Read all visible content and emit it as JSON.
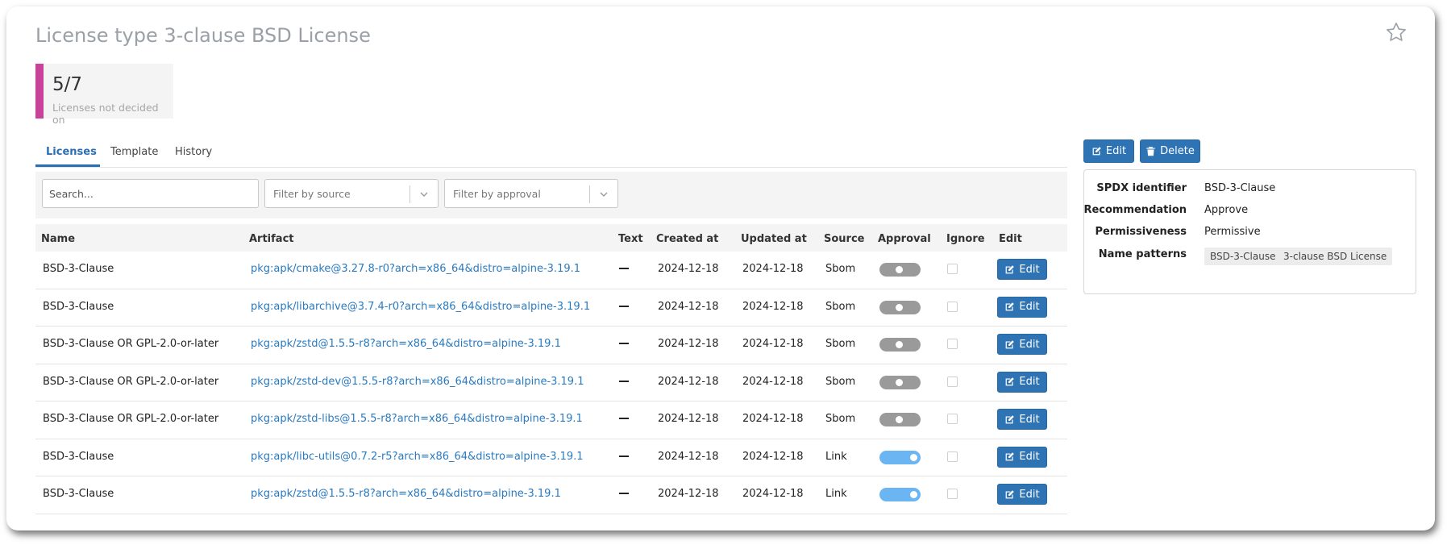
{
  "page": {
    "title": "License type 3-clause BSD License",
    "favorite_icon": "star-icon"
  },
  "stat": {
    "value": "5/7",
    "label": "Licenses not decided on",
    "accent_color": "#c9429a"
  },
  "tabs": [
    {
      "label": "Licenses",
      "active": true
    },
    {
      "label": "Template",
      "active": false
    },
    {
      "label": "History",
      "active": false
    }
  ],
  "filters": {
    "search_placeholder": "Search...",
    "source_placeholder": "Filter by source",
    "approval_placeholder": "Filter by approval"
  },
  "table": {
    "columns": [
      "Name",
      "Artifact",
      "Text",
      "Created at",
      "Updated at",
      "Source",
      "Approval",
      "Ignore",
      "Edit"
    ],
    "edit_label": "Edit",
    "rows": [
      {
        "name": "BSD-3-Clause",
        "artifact": "pkg:apk/cmake@3.27.8-r0?arch=x86_64&distro=alpine-3.19.1",
        "text": "—",
        "created": "2024-12-18",
        "updated": "2024-12-18",
        "source": "Sbom",
        "approved": false,
        "ignored": false
      },
      {
        "name": "BSD-3-Clause",
        "artifact": "pkg:apk/libarchive@3.7.4-r0?arch=x86_64&distro=alpine-3.19.1",
        "text": "—",
        "created": "2024-12-18",
        "updated": "2024-12-18",
        "source": "Sbom",
        "approved": false,
        "ignored": false
      },
      {
        "name": "BSD-3-Clause OR GPL-2.0-or-later",
        "artifact": "pkg:apk/zstd@1.5.5-r8?arch=x86_64&distro=alpine-3.19.1",
        "text": "—",
        "created": "2024-12-18",
        "updated": "2024-12-18",
        "source": "Sbom",
        "approved": false,
        "ignored": false
      },
      {
        "name": "BSD-3-Clause OR GPL-2.0-or-later",
        "artifact": "pkg:apk/zstd-dev@1.5.5-r8?arch=x86_64&distro=alpine-3.19.1",
        "text": "—",
        "created": "2024-12-18",
        "updated": "2024-12-18",
        "source": "Sbom",
        "approved": false,
        "ignored": false
      },
      {
        "name": "BSD-3-Clause OR GPL-2.0-or-later",
        "artifact": "pkg:apk/zstd-libs@1.5.5-r8?arch=x86_64&distro=alpine-3.19.1",
        "text": "—",
        "created": "2024-12-18",
        "updated": "2024-12-18",
        "source": "Sbom",
        "approved": false,
        "ignored": false
      },
      {
        "name": "BSD-3-Clause",
        "artifact": "pkg:apk/libc-utils@0.7.2-r5?arch=x86_64&distro=alpine-3.19.1",
        "text": "—",
        "created": "2024-12-18",
        "updated": "2024-12-18",
        "source": "Link",
        "approved": true,
        "ignored": false
      },
      {
        "name": "BSD-3-Clause",
        "artifact": "pkg:apk/zstd@1.5.5-r8?arch=x86_64&distro=alpine-3.19.1",
        "text": "—",
        "created": "2024-12-18",
        "updated": "2024-12-18",
        "source": "Link",
        "approved": true,
        "ignored": false
      }
    ]
  },
  "side": {
    "edit_label": "Edit",
    "delete_label": "Delete",
    "props": {
      "spdx_label": "SPDX identifier",
      "spdx_value": "BSD-3-Clause",
      "recommendation_label": "Recommendation",
      "recommendation_value": "Approve",
      "permissiveness_label": "Permissiveness",
      "permissiveness_value": "Permissive",
      "name_patterns_label": "Name patterns",
      "name_patterns": [
        "BSD-3-Clause",
        "3-clause BSD License"
      ]
    }
  },
  "colors": {
    "primary": "#2e74b5",
    "link": "#2a7ac0",
    "toggle_on": "#6bb6f2",
    "toggle_off": "#9a9a9a"
  }
}
